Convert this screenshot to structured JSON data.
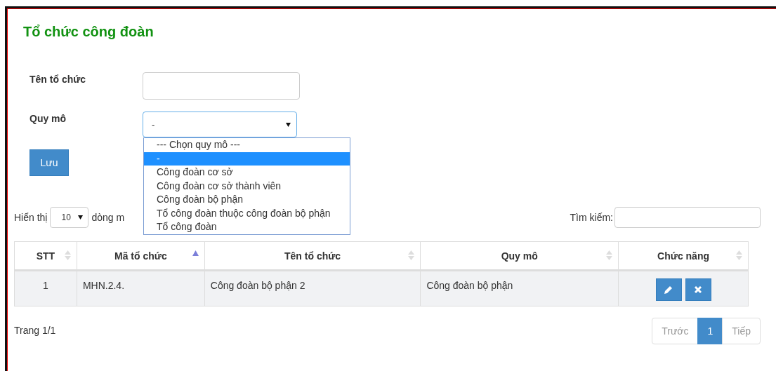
{
  "title": "Tổ chức công đoàn",
  "form": {
    "fields": [
      {
        "kind": "text",
        "label": "Tên tổ chức"
      },
      {
        "kind": "select",
        "label": "Quy mô",
        "value": "-",
        "expanded": true,
        "options": [
          {
            "label": "--- Chọn quy mô ---",
            "selected": false
          },
          {
            "label": "-",
            "selected": true
          },
          {
            "label": "Công đoàn cơ sở",
            "selected": false
          },
          {
            "label": "Công đoàn cơ sở thành viên",
            "selected": false
          },
          {
            "label": "Công đoàn bộ phận",
            "selected": false
          },
          {
            "label": "Tổ công đoàn thuộc công đoàn bộ phận",
            "selected": false
          },
          {
            "label": "Tổ công đoàn",
            "selected": false
          }
        ]
      }
    ],
    "save_button": "Lưu"
  },
  "length_control": {
    "prefix": "Hiển thị",
    "value": "10",
    "suffix": "dòng m"
  },
  "search": {
    "label": "Tìm kiếm:"
  },
  "table": {
    "columns": [
      {
        "label": "STT",
        "sorted": false
      },
      {
        "label": "Mã tổ chức",
        "sorted": true
      },
      {
        "label": "Tên tổ chức",
        "sorted": false
      },
      {
        "label": "Quy mô",
        "sorted": false
      },
      {
        "label": "Chức năng",
        "sorted": false
      }
    ],
    "rows": [
      {
        "cells": [
          "1",
          "MHN.2.4.",
          "Công đoàn bộ phận 2",
          "Công đoàn bộ phận"
        ]
      }
    ]
  },
  "info": "Trang 1/1",
  "pagination": [
    {
      "label": "Trước",
      "kind": "prev",
      "disabled": true,
      "selected": false
    },
    {
      "label": "1",
      "kind": "page",
      "disabled": false,
      "selected": true
    },
    {
      "label": "Tiếp",
      "kind": "next",
      "disabled": true,
      "selected": false
    }
  ]
}
